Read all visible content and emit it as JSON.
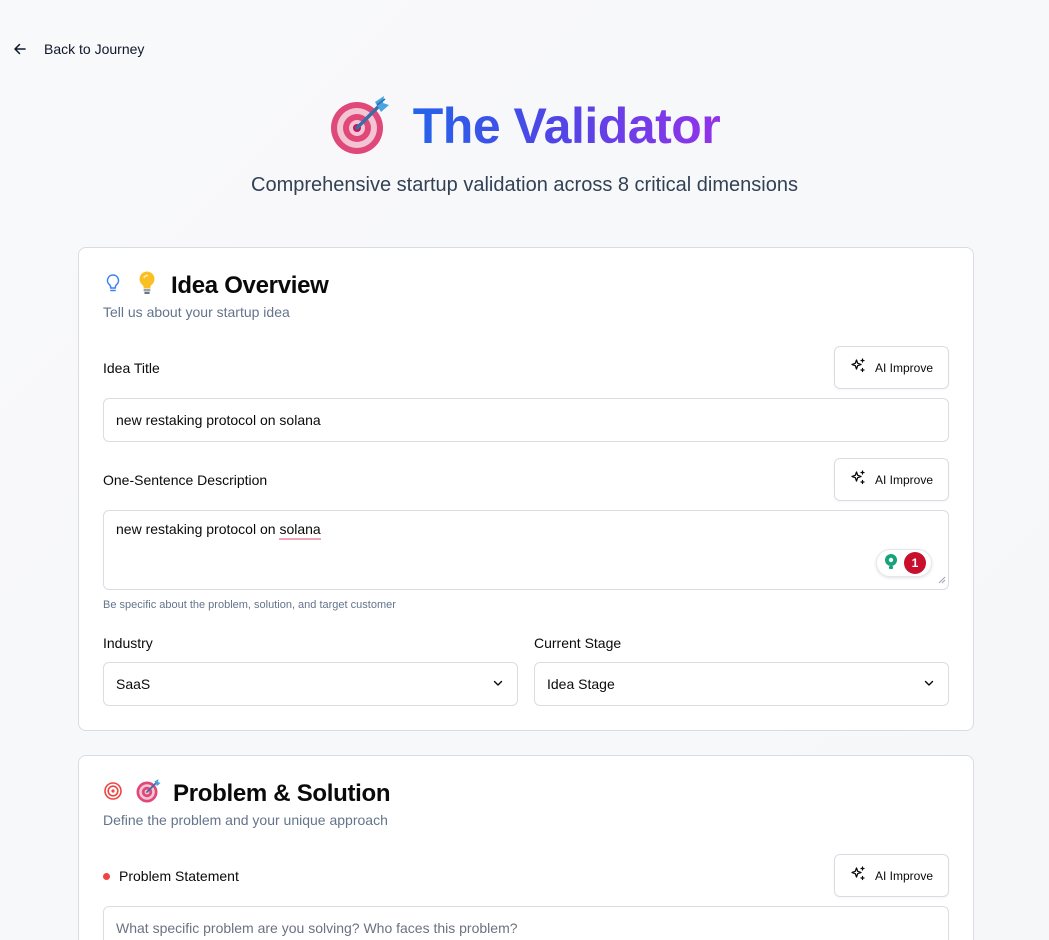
{
  "nav": {
    "back_label": "Back to Journey"
  },
  "hero": {
    "title": "The Validator",
    "subtitle": "Comprehensive startup validation across 8 critical dimensions"
  },
  "idea_overview": {
    "title": "Idea Overview",
    "description": "Tell us about your startup idea",
    "idea_title": {
      "label": "Idea Title",
      "value": "new restaking protocol on solana"
    },
    "one_sentence": {
      "label": "One-Sentence Description",
      "value_prefix": "new restaking protocol on ",
      "value_flagged": "solana",
      "help": "Be specific about the problem, solution, and target customer",
      "grammar_count": "1"
    },
    "industry": {
      "label": "Industry",
      "value": "SaaS"
    },
    "stage": {
      "label": "Current Stage",
      "value": "Idea Stage"
    }
  },
  "problem_solution": {
    "title": "Problem & Solution",
    "description": "Define the problem and your unique approach",
    "problem_statement": {
      "label": "Problem Statement",
      "placeholder": "What specific problem are you solving? Who faces this problem?"
    }
  },
  "ai_improve_label": "AI Improve",
  "colors": {
    "title_gradient_start": "#2563eb",
    "title_gradient_end": "#9333ea",
    "required_dot": "#ef4444",
    "grammar_badge": "#c8102e"
  },
  "icons": {
    "back": "arrow-left-icon",
    "hero": "dart-target-icon",
    "idea": "lightbulb-icon",
    "problem": "target-icon",
    "ai": "sparkles-icon",
    "select": "chevron-down-icon"
  }
}
